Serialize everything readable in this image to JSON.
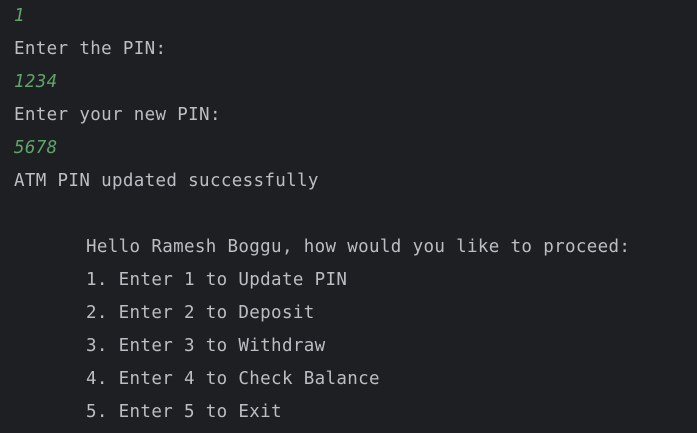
{
  "console": {
    "lines": [
      {
        "text": "1",
        "kind": "input"
      },
      {
        "text": "Enter the PIN:",
        "kind": "output"
      },
      {
        "text": "1234",
        "kind": "input"
      },
      {
        "text": "Enter your new PIN:",
        "kind": "output"
      },
      {
        "text": "5678",
        "kind": "input"
      },
      {
        "text": "ATM PIN updated successfully",
        "kind": "output"
      },
      {
        "text": "Hello Ramesh Boggu, how would you like to proceed:",
        "kind": "output"
      },
      {
        "text": "1. Enter 1 to Update PIN",
        "kind": "output"
      },
      {
        "text": "2. Enter 2 to Deposit",
        "kind": "output"
      },
      {
        "text": "3. Enter 3 to Withdraw",
        "kind": "output"
      },
      {
        "text": "4. Enter 4 to Check Balance",
        "kind": "output"
      },
      {
        "text": "5. Enter 5 to Exit",
        "kind": "output"
      }
    ]
  },
  "colors": {
    "background": "#1e1f22",
    "output_text": "#bcbec4",
    "user_input_text": "#5fa56a"
  }
}
